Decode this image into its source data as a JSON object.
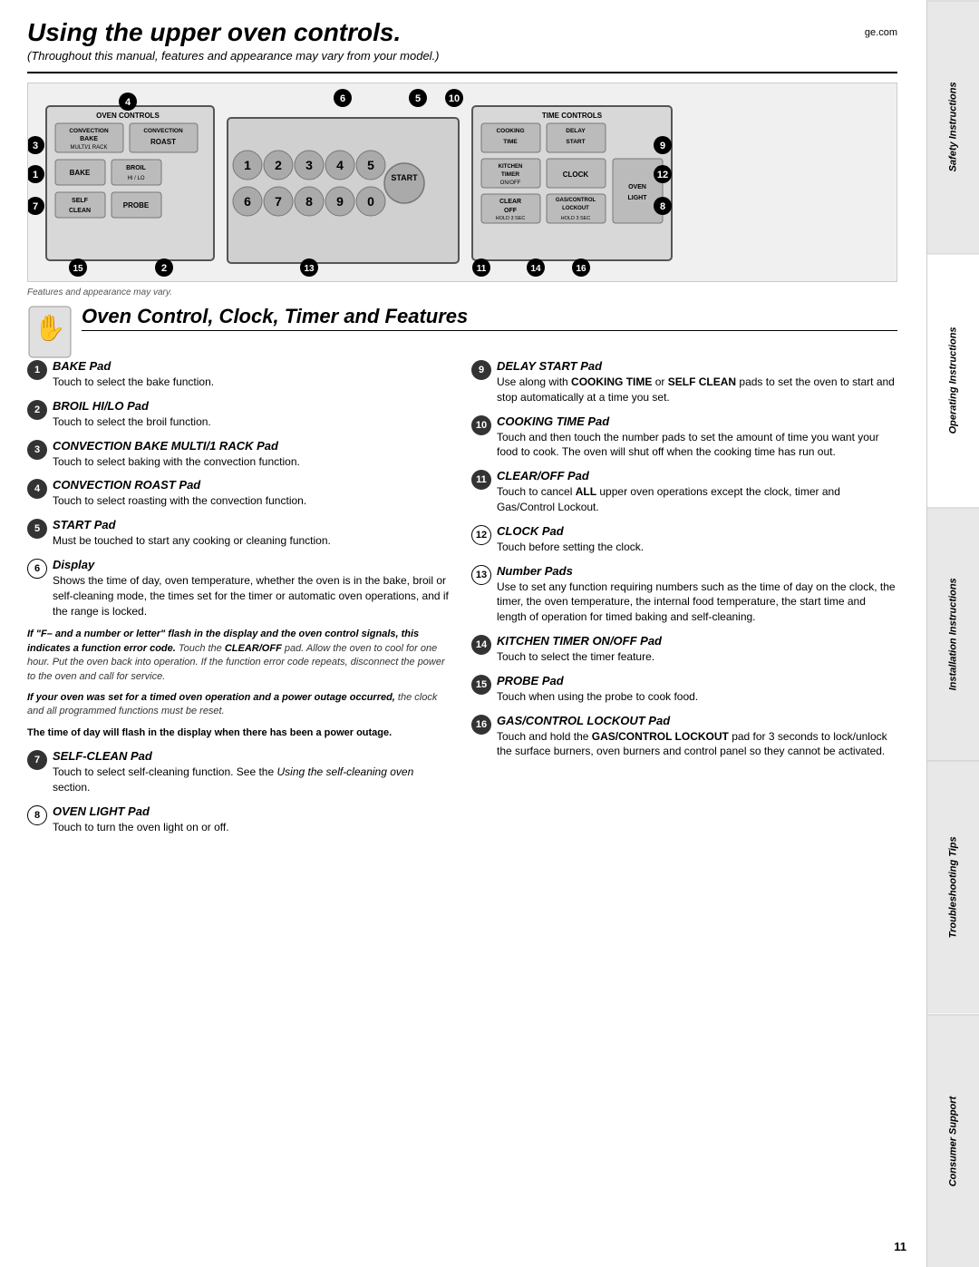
{
  "page": {
    "title": "Using the upper oven controls.",
    "website": "ge.com",
    "subtitle": "(Throughout this manual, features and appearance may vary from your model.)",
    "features_note": "Features and appearance may vary.",
    "section_title": "Oven Control, Clock, Timer and Features",
    "page_number": "11"
  },
  "sidebar": {
    "tabs": [
      {
        "label": "Safety Instructions",
        "active": false
      },
      {
        "label": "Operating Instructions",
        "active": true
      },
      {
        "label": "Installation Instructions",
        "active": false
      },
      {
        "label": "Troubleshooting Tips",
        "active": false
      },
      {
        "label": "Consumer Support",
        "active": false
      }
    ]
  },
  "diagram": {
    "left_panel_label": "Oven Controls",
    "right_panel_label": "Time Controls",
    "buttons": {
      "convection_bake": "Convection\nBake\nMulti/1 Rack",
      "convection_roast": "Convection\nRoast",
      "bake": "Bake",
      "broil": "Broil\nHi / Lo",
      "self_clean": "Self\nClean",
      "probe": "Probe",
      "cooking_time": "Cooking\nTime",
      "delay_start": "Delay\nStart",
      "kitchen_timer": "Kitchen\nTimer\nOn/Off",
      "clock": "Clock",
      "start": "Start",
      "clear_off": "Clear\nOff\nHold 3 Sec",
      "gas_control_lockout": "Gas/Control\nLockout\nHold 3 Sec",
      "oven_light": "Oven\nLight"
    }
  },
  "features": {
    "left_col": [
      {
        "num": "1",
        "filled": true,
        "title": "BAKE Pad",
        "desc": "Touch to select the bake function."
      },
      {
        "num": "2",
        "filled": true,
        "title": "BROIL HI/LO Pad",
        "desc": "Touch to select the broil function."
      },
      {
        "num": "3",
        "filled": true,
        "title": "CONVECTION BAKE MULTI/1 RACK Pad",
        "desc": "Touch to select baking with the convection function."
      },
      {
        "num": "4",
        "filled": true,
        "title": "CONVECTION ROAST Pad",
        "desc": "Touch to select roasting with the convection function."
      },
      {
        "num": "5",
        "filled": true,
        "title": "START Pad",
        "desc": "Must be touched to start any cooking or cleaning function."
      },
      {
        "num": "6",
        "filled": false,
        "title": "Display",
        "desc": "Shows the time of day, oven temperature, whether the oven is in the bake, broil or self-cleaning mode, the times set for the timer or automatic oven operations, and if the range is locked."
      },
      {
        "num": "7",
        "filled": true,
        "title": "SELF-CLEAN Pad",
        "desc": "Touch to select self-cleaning function. See the Using the self-cleaning oven section."
      },
      {
        "num": "8",
        "filled": false,
        "title": "OVEN LIGHT Pad",
        "desc": "Touch to turn the oven light on or off."
      }
    ],
    "right_col": [
      {
        "num": "9",
        "filled": true,
        "title": "DELAY START Pad",
        "desc": "Use along with COOKING TIME or SELF CLEAN pads to set the oven to start and stop automatically at a time you set."
      },
      {
        "num": "10",
        "filled": true,
        "title": "COOKING TIME Pad",
        "desc": "Touch and then touch the number pads to set the amount of time you want your food to cook. The oven will shut off when the cooking time has run out."
      },
      {
        "num": "11",
        "filled": true,
        "title": "CLEAR/OFF Pad",
        "desc": "Touch to cancel ALL upper oven operations except the clock, timer and Gas/Control Lockout."
      },
      {
        "num": "12",
        "filled": false,
        "title": "CLOCK Pad",
        "desc": "Touch before setting the clock."
      },
      {
        "num": "13",
        "filled": false,
        "title": "Number Pads",
        "desc": "Use to set any function requiring numbers such as the time of day on the clock, the timer, the oven temperature, the internal food temperature, the start time and length of operation for timed baking and self-cleaning."
      },
      {
        "num": "14",
        "filled": true,
        "title": "KITCHEN TIMER ON/OFF Pad",
        "desc": "Touch to select the timer feature."
      },
      {
        "num": "15",
        "filled": true,
        "title": "PROBE Pad",
        "desc": "Touch when using the probe to cook food."
      },
      {
        "num": "16",
        "filled": true,
        "title": "GAS/CONTROL LOCKOUT Pad",
        "desc": "Touch and hold the GAS/CONTROL LOCKOUT pad for 3 seconds to lock/unlock the surface burners, oven burners and control panel so they cannot be activated."
      }
    ],
    "warnings": [
      {
        "text": "If \"F– and a number or letter\" flash in the display and the oven control signals, this indicates a function error code. Touch the CLEAR/OFF pad. Allow the oven to cool for one hour. Put the oven back into operation. If the function error code repeats, disconnect the power to the oven and call for service."
      },
      {
        "text": "If your oven was set for a timed oven operation and a power outage occurred, the clock and all programmed functions must be reset."
      },
      {
        "text": "The time of day will flash in the display when there has been a power outage."
      }
    ]
  }
}
